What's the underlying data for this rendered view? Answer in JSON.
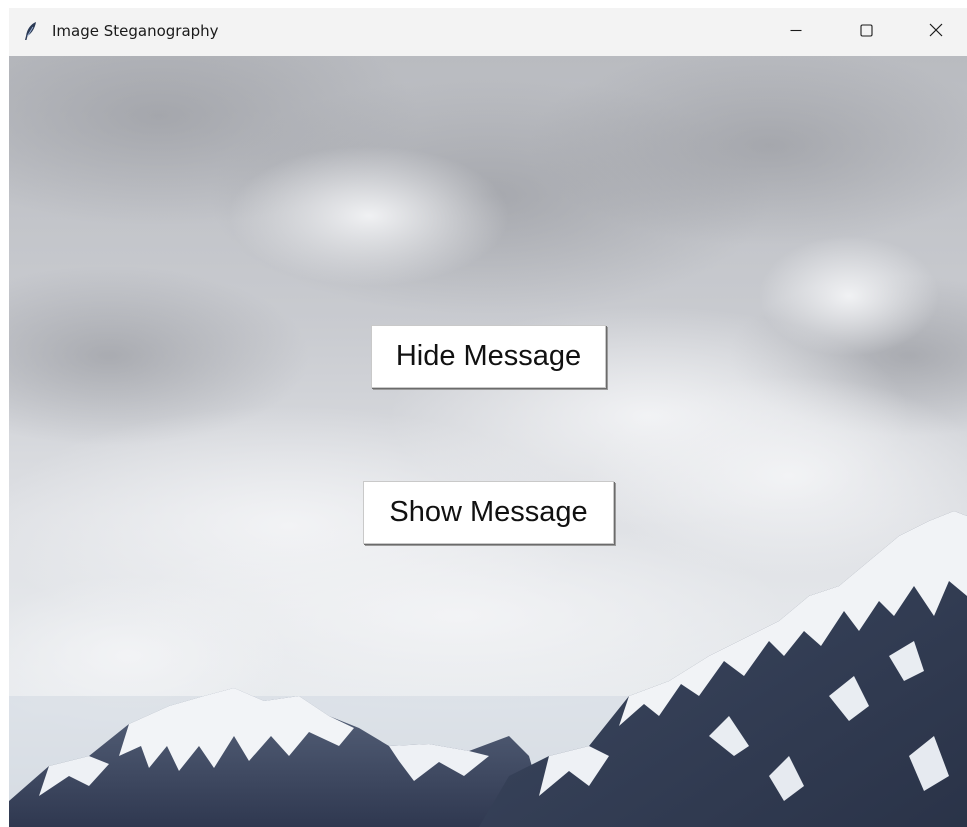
{
  "window": {
    "title": "Image Steganography"
  },
  "controls": {
    "minimize_icon": "minimize-icon",
    "maximize_icon": "maximize-icon",
    "close_icon": "close-icon"
  },
  "main": {
    "hide_button_label": "Hide Message",
    "show_button_label": "Show Message"
  },
  "colors": {
    "titlebar": "#f3f3f3",
    "button_bg": "#ffffff",
    "text": "#111111"
  }
}
